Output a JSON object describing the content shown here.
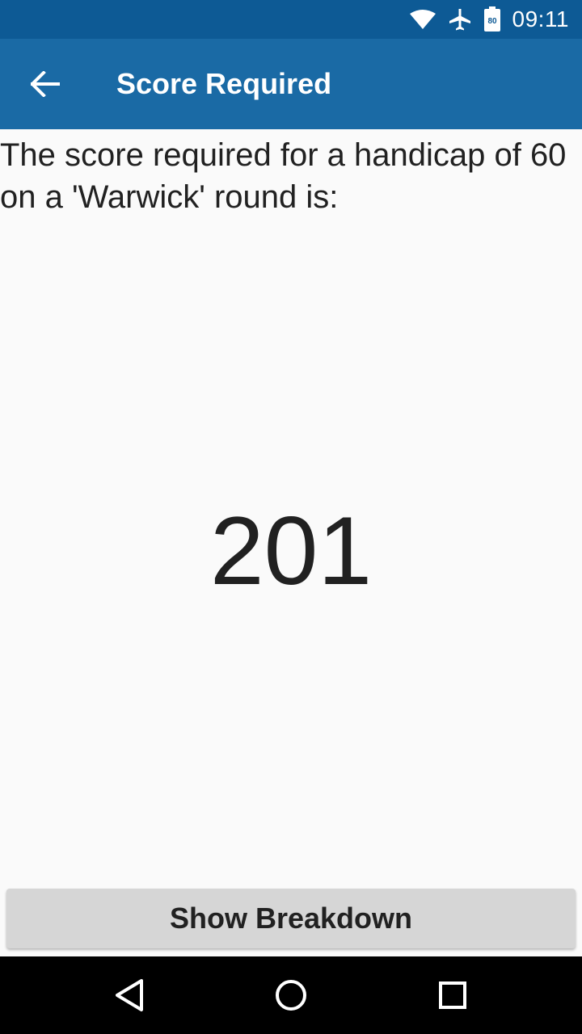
{
  "status_bar": {
    "time": "09:11",
    "battery_level": "80",
    "icons": [
      "wifi-icon",
      "airplane-icon",
      "battery-icon"
    ]
  },
  "app_bar": {
    "title": "Score Required",
    "back_icon": "arrow-back-icon"
  },
  "main": {
    "prompt": "The score required for a handicap of 60 on a 'Warwick' round is:",
    "score": "201"
  },
  "actions": {
    "breakdown_label": "Show Breakdown"
  },
  "nav_bar": {
    "icons": [
      "back-triangle-icon",
      "home-circle-icon",
      "recents-square-icon"
    ]
  },
  "colors": {
    "status_bar": "#0d5a95",
    "app_bar": "#1a6aa5",
    "background": "#fafafa",
    "button": "#d6d6d6",
    "text": "#212121"
  }
}
